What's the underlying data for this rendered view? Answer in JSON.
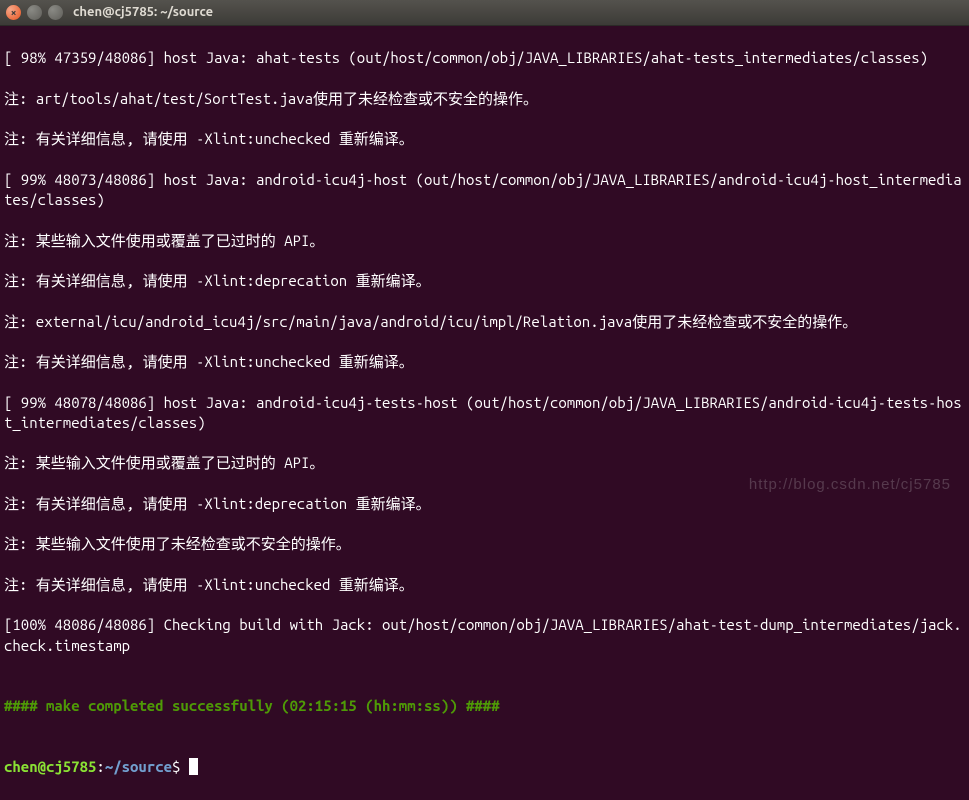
{
  "window": {
    "title": "chen@cj5785: ~/source"
  },
  "terminal": {
    "lines": [
      "[ 98% 47359/48086] host Java: ahat-tests (out/host/common/obj/JAVA_LIBRARIES/ahat-tests_intermediates/classes)",
      "注: art/tools/ahat/test/SortTest.java使用了未经检查或不安全的操作。",
      "注: 有关详细信息, 请使用 -Xlint:unchecked 重新编译。",
      "[ 99% 48073/48086] host Java: android-icu4j-host (out/host/common/obj/JAVA_LIBRARIES/android-icu4j-host_intermediates/classes)",
      "注: 某些输入文件使用或覆盖了已过时的 API。",
      "注: 有关详细信息, 请使用 -Xlint:deprecation 重新编译。",
      "注: external/icu/android_icu4j/src/main/java/android/icu/impl/Relation.java使用了未经检查或不安全的操作。",
      "注: 有关详细信息, 请使用 -Xlint:unchecked 重新编译。",
      "[ 99% 48078/48086] host Java: android-icu4j-tests-host (out/host/common/obj/JAVA_LIBRARIES/android-icu4j-tests-host_intermediates/classes)",
      "注: 某些输入文件使用或覆盖了已过时的 API。",
      "注: 有关详细信息, 请使用 -Xlint:deprecation 重新编译。",
      "注: 某些输入文件使用了未经检查或不安全的操作。",
      "注: 有关详细信息, 请使用 -Xlint:unchecked 重新编译。",
      "[100% 48086/48086] Checking build with Jack: out/host/common/obj/JAVA_LIBRARIES/ahat-test-dump_intermediates/jack.check.timestamp",
      ""
    ],
    "success_line": "#### make completed successfully (02:15:15 (hh:mm:ss)) ####",
    "blank_after_success": "",
    "prompt": {
      "user_host": "chen@cj5785",
      "sep1": ":",
      "path": "~/source",
      "sep2": "$"
    }
  },
  "watermark": "http://blog.csdn.net/cj5785"
}
